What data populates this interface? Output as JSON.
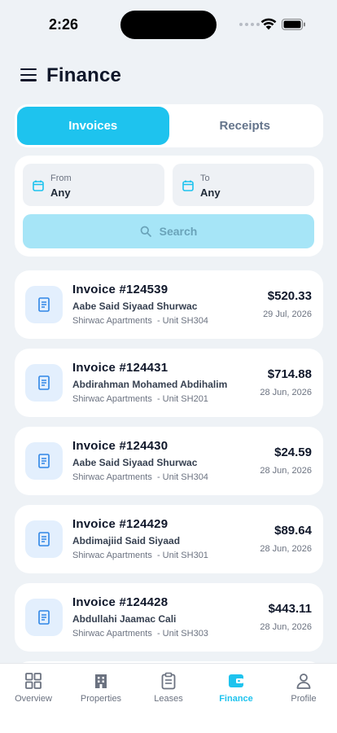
{
  "status_bar": {
    "time": "2:26"
  },
  "header": {
    "title": "Finance"
  },
  "tabs": [
    {
      "label": "Invoices",
      "active": true
    },
    {
      "label": "Receipts",
      "active": false
    }
  ],
  "filters": {
    "from": {
      "label": "From",
      "value": "Any"
    },
    "to": {
      "label": "To",
      "value": "Any"
    },
    "search_label": "Search"
  },
  "invoices": [
    {
      "number": "Invoice #124539",
      "tenant": "Aabe Said Siyaad Shurwac",
      "property": "Shirwac Apartments",
      "unit": "- Unit SH304",
      "amount": "$520.33",
      "date": "29 Jul, 2026"
    },
    {
      "number": "Invoice #124431",
      "tenant": "Abdirahman Mohamed Abdihalim",
      "property": "Shirwac Apartments",
      "unit": "- Unit SH201",
      "amount": "$714.88",
      "date": "28 Jun, 2026"
    },
    {
      "number": "Invoice #124430",
      "tenant": "Aabe Said Siyaad Shurwac",
      "property": "Shirwac Apartments",
      "unit": "- Unit SH304",
      "amount": "$24.59",
      "date": "28 Jun, 2026"
    },
    {
      "number": "Invoice #124429",
      "tenant": "Abdimajiid Said Siyaad",
      "property": "Shirwac Apartments",
      "unit": "- Unit SH301",
      "amount": "$89.64",
      "date": "28 Jun, 2026"
    },
    {
      "number": "Invoice #124428",
      "tenant": "Abdullahi Jaamac Cali",
      "property": "Shirwac Apartments",
      "unit": "- Unit SH303",
      "amount": "$443.11",
      "date": "28 Jun, 2026"
    }
  ],
  "bottom_nav": [
    {
      "label": "Overview",
      "icon": "grid-icon",
      "active": false
    },
    {
      "label": "Properties",
      "icon": "building-icon",
      "active": false
    },
    {
      "label": "Leases",
      "icon": "clipboard-icon",
      "active": false
    },
    {
      "label": "Finance",
      "icon": "wallet-icon",
      "active": true
    },
    {
      "label": "Profile",
      "icon": "user-icon",
      "active": false
    }
  ],
  "colors": {
    "accent": "#1ec3ee",
    "search_button": "#a6e5f7",
    "background": "#eef2f6"
  }
}
